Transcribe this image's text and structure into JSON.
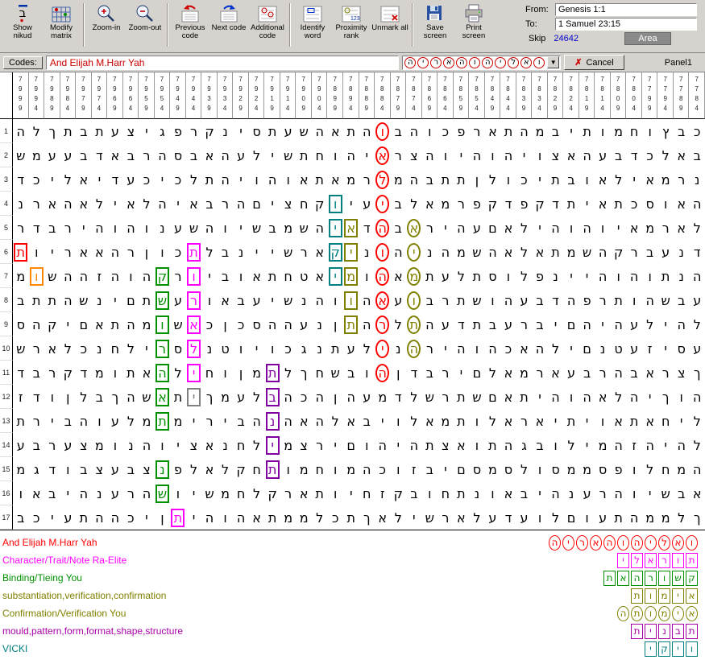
{
  "toolbar": {
    "buttons": [
      {
        "id": "show-nikud",
        "label": "Show nikud"
      },
      {
        "id": "modify-matrix",
        "label": "Modify matrix"
      },
      {
        "id": "zoom-in",
        "label": "Zoom-in"
      },
      {
        "id": "zoom-out",
        "label": "Zoom-out"
      },
      {
        "id": "previous-code",
        "label": "Previous code"
      },
      {
        "id": "next-code",
        "label": "Next code"
      },
      {
        "id": "additional-code",
        "label": "Additional code"
      },
      {
        "id": "identify-word",
        "label": "Identify word"
      },
      {
        "id": "proximity-rank",
        "label": "Proximity rank"
      },
      {
        "id": "unmark-all",
        "label": "Unmark all"
      },
      {
        "id": "save-screen",
        "label": "Save screen"
      },
      {
        "id": "print-screen",
        "label": "Print screen"
      }
    ],
    "from_label": "From:",
    "from_value": "Genesis 1:1",
    "to_label": "To:",
    "to_value": "1 Samuel 23:15",
    "skip_label": "Skip",
    "skip_value": "24642",
    "area_label": "Area"
  },
  "codes_bar": {
    "label": "Codes:",
    "value": "And Elijah M.Harr Yah",
    "code_word": "ואליהוהאריה",
    "dropdown_icon": "▼",
    "cancel_icon": "✗",
    "cancel_label": "Cancel",
    "panel_label": "Panel1"
  },
  "matrix": {
    "col_headers": [
      "7999",
      "7994",
      "7989",
      "7984",
      "7979",
      "7974",
      "7969",
      "7964",
      "7959",
      "7954",
      "7949",
      "7944",
      "7939",
      "7934",
      "7929",
      "7924",
      "7919",
      "7914",
      "7909",
      "7904",
      "7899",
      "7894",
      "7889",
      "7884",
      "7879",
      "7874",
      "7869",
      "7864",
      "7859",
      "7854",
      "7849",
      "7844",
      "7839",
      "7834",
      "7829",
      "7824",
      "7819",
      "7814",
      "7809",
      "7804",
      "7799",
      "7794",
      "7789",
      "7784"
    ],
    "row_numbers": [
      1,
      2,
      3,
      4,
      5,
      6,
      7,
      8,
      9,
      10,
      11,
      12,
      13,
      14,
      15,
      16,
      17
    ],
    "rows": [
      "הלךתבתעציגפרקניסתעשהאתהובהוכפראתהמביתומחוץבכ",
      "שמעעבדאברהסבאהעלישתחוהיארצהויהוהיוצאהעבדכלאב",
      "דכילאידעכיכלתהיוהואתאמרלמהבתתןלוכיתבואליאמרנ",
      "נראהאליאלהיאברהםיצחקויעיבלאמרפקדפקדתיאתכסואה",
      "רדבריהוהונעשהוישבמשהיאדהבאריהעםאליהוהויאמראל",
      "תויראאהרןוכתלבניישראקינוהינהמשהאלאתמשהקרבענד",
      "מושההזהוהקרויבואתחטאימוהאמתעלתסולפנייהוהותנה",
      "בתתהשניםתשערואבעישנהווהאעוברתשוהעבדהפרתוהשבע",
      "סהקיםאתהמושאכןכסההענןתהרלתהעדתבערביםהיהעליהל",
      "שראלכנחלירסלנטויוכגנתעלינהריהוהכאהליםנטעזיסע",
      "דברקדמותאהליחוןמתלךחשבוהןדבריםלאמראעברהבארצך",
      "זדוןלבךהשאתיךמעלבהכהןהעמדלשרתשםאתיהוהאלהיךוה",
      "תריבהועלמתמיריבהנהאהלאביולאמתולאראיתיואתאחיל",
      "עברעצמונהויצאנחלימצריםוהיהתצאותהגבולימהזהיהל",
      "מגדובצעבצנפלאלקחתומחומהכוזביםסמסלוסממספולחמה",
      "ואביהנערהשוישמחלקראתויחזקבוחתנואביהנערהוישבא",
      "בכיעתההכיןתיהוהאתממלכתךאלישראלעדעולםועתהממלך"
    ],
    "highlights": [
      [
        1,
        24,
        "c",
        "#ff0000"
      ],
      [
        2,
        24,
        "c",
        "#ff0000"
      ],
      [
        3,
        24,
        "c",
        "#ff0000"
      ],
      [
        4,
        24,
        "c",
        "#ff0000"
      ],
      [
        5,
        24,
        "c",
        "#ff0000"
      ],
      [
        6,
        24,
        "c",
        "#ff0000"
      ],
      [
        7,
        24,
        "c",
        "#ff0000"
      ],
      [
        8,
        24,
        "c",
        "#ff0000"
      ],
      [
        9,
        24,
        "c",
        "#ff0000"
      ],
      [
        10,
        24,
        "c",
        "#ff0000"
      ],
      [
        11,
        24,
        "c",
        "#ff0000"
      ],
      [
        6,
        1,
        "b",
        "#ff0000"
      ],
      [
        7,
        2,
        "b",
        "#ff8800"
      ],
      [
        7,
        10,
        "b",
        "#009000"
      ],
      [
        8,
        10,
        "b",
        "#009000"
      ],
      [
        9,
        10,
        "b",
        "#009000"
      ],
      [
        10,
        10,
        "b",
        "#009000"
      ],
      [
        11,
        10,
        "b",
        "#009000"
      ],
      [
        12,
        10,
        "b",
        "#009000"
      ],
      [
        13,
        10,
        "b",
        "#009000"
      ],
      [
        15,
        10,
        "b",
        "#009000"
      ],
      [
        16,
        10,
        "b",
        "#009000"
      ],
      [
        6,
        12,
        "b",
        "#ff00ff"
      ],
      [
        7,
        12,
        "b",
        "#ff00ff"
      ],
      [
        8,
        12,
        "b",
        "#ff00ff"
      ],
      [
        9,
        12,
        "b",
        "#ff00ff"
      ],
      [
        10,
        12,
        "b",
        "#ff00ff"
      ],
      [
        11,
        12,
        "b",
        "#ff00ff"
      ],
      [
        17,
        11,
        "b",
        "#ff00ff"
      ],
      [
        12,
        12,
        "b",
        "#808080"
      ],
      [
        5,
        22,
        "b",
        "#808000"
      ],
      [
        6,
        22,
        "b",
        "#808000"
      ],
      [
        7,
        22,
        "b",
        "#808000"
      ],
      [
        8,
        22,
        "b",
        "#808000"
      ],
      [
        9,
        22,
        "b",
        "#808000"
      ],
      [
        5,
        26,
        "c",
        "#808000"
      ],
      [
        6,
        26,
        "c",
        "#808000"
      ],
      [
        7,
        26,
        "c",
        "#808000"
      ],
      [
        8,
        26,
        "c",
        "#808000"
      ],
      [
        9,
        26,
        "c",
        "#808000"
      ],
      [
        10,
        26,
        "c",
        "#808000"
      ],
      [
        11,
        17,
        "b",
        "#8000a0"
      ],
      [
        12,
        17,
        "b",
        "#8000a0"
      ],
      [
        13,
        17,
        "b",
        "#8000a0"
      ],
      [
        14,
        17,
        "b",
        "#8000a0"
      ],
      [
        15,
        17,
        "b",
        "#8000a0"
      ],
      [
        4,
        21,
        "b",
        "#008080"
      ],
      [
        5,
        21,
        "b",
        "#008080"
      ],
      [
        6,
        21,
        "b",
        "#008080"
      ],
      [
        7,
        21,
        "b",
        "#008080"
      ]
    ]
  },
  "legend": {
    "entries": [
      {
        "label": "And Elijah M.Harr Yah",
        "color": "#ff0000",
        "word": "ואליהוהאריה",
        "shape": "circle"
      },
      {
        "label": "Character/Trait/Note Ra-Elite",
        "color": "#ff00ff",
        "word": "תוראלי",
        "shape": "box"
      },
      {
        "label": "Binding/Tieing You",
        "color": "#009000",
        "word": "קשורהאת",
        "shape": "box"
      },
      {
        "label": "substantiation,verification,confirmation",
        "color": "#808000",
        "word": "אימות",
        "shape": "box"
      },
      {
        "label": "Confirmation/Verification You",
        "color": "#808000",
        "word": "אימותה",
        "shape": "circle"
      },
      {
        "label": "mould,pattern,form,format,shape,structure",
        "color": "#aa00aa",
        "word": "תבנית",
        "shape": "box"
      },
      {
        "label": "VICKI",
        "color": "#008080",
        "word": "ויקי",
        "shape": "box"
      }
    ]
  }
}
